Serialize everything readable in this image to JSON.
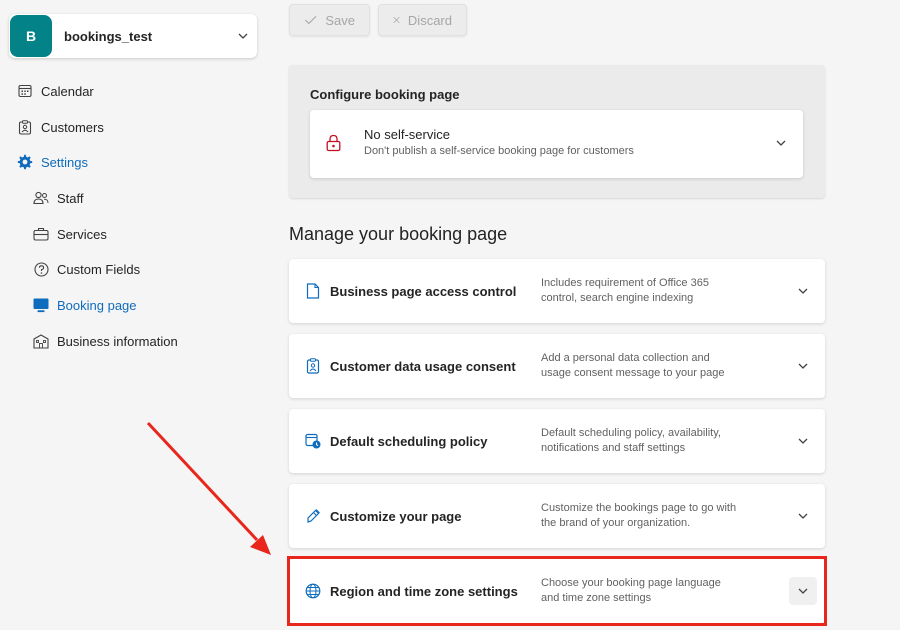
{
  "account": {
    "initial": "B",
    "name": "bookings_test"
  },
  "nav": {
    "calendar": "Calendar",
    "customers": "Customers",
    "settings": "Settings",
    "staff": "Staff",
    "services": "Services",
    "custom_fields": "Custom Fields",
    "booking_page": "Booking page",
    "business_information": "Business information"
  },
  "toolbar": {
    "save_label": "Save",
    "discard_label": "Discard"
  },
  "configure": {
    "title": "Configure booking page",
    "selected_title": "No self-service",
    "selected_desc": "Don't publish a self-service booking page for customers"
  },
  "manage": {
    "heading": "Manage your booking page",
    "rows": [
      {
        "title": "Business page access control",
        "desc": "Includes requirement of Office 365 control, search engine indexing",
        "icon": "document-icon"
      },
      {
        "title": "Customer data usage consent",
        "desc": "Add a personal data collection and usage consent message to your page",
        "icon": "clipboard-person-icon"
      },
      {
        "title": "Default scheduling policy",
        "desc": "Default scheduling policy, availability, notifications and staff settings",
        "icon": "calendar-clock-icon"
      },
      {
        "title": "Customize your page",
        "desc": "Customize the bookings page to go with the brand of your organization.",
        "icon": "paint-brush-icon"
      },
      {
        "title": "Region and time zone settings",
        "desc": "Choose your booking page language and time zone settings",
        "icon": "globe-icon"
      }
    ]
  },
  "colors": {
    "accent": "#0f6cbd",
    "avatar": "#038387",
    "highlight": "#e8261c"
  }
}
